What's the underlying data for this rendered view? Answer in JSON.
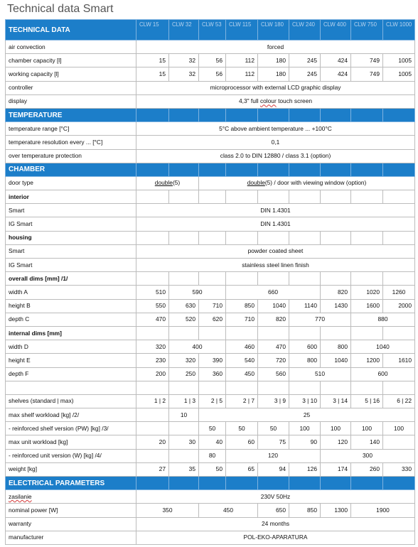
{
  "title": "Technical data Smart",
  "models": [
    "CLW 15",
    "CLW 32",
    "CLW 53",
    "CLW 115",
    "CLW 180",
    "CLW 240",
    "CLW 400",
    "CLW 750",
    "CLW 1000"
  ],
  "sections": {
    "technical": "TECHNICAL DATA",
    "temperature": "TEMPERATURE",
    "chamber": "CHAMBER",
    "electrical": "ELECTRICAL PARAMETERS"
  },
  "rows": {
    "air_convection": {
      "label": "air convection",
      "value": "forced"
    },
    "chamber_capacity": {
      "label": "chamber capacity [l]",
      "values": [
        "15",
        "32",
        "56",
        "112",
        "180",
        "245",
        "424",
        "749",
        "1005"
      ]
    },
    "working_capacity": {
      "label": "working capacity [l]",
      "values": [
        "15",
        "32",
        "56",
        "112",
        "180",
        "245",
        "424",
        "749",
        "1005"
      ]
    },
    "controller": {
      "label": "controller",
      "value": "microprocessor with external LCD graphic display"
    },
    "display": {
      "label": "display",
      "value_a": "4,3\" full ",
      "value_b": "colour",
      "value_c": " touch screen"
    },
    "temp_range": {
      "label": "temperature range [°C]",
      "value": "5°C above ambient temperature ... +100°C"
    },
    "temp_res": {
      "label": "temperature resolution every ... [°C]",
      "value": "0,1"
    },
    "over_temp": {
      "label": "over temperature protection",
      "value": "class 2.0 to DIN 12880 / class 3.1 (option)"
    },
    "door_type": {
      "label": "door type",
      "a_word": "double",
      "a_rest": "(5)",
      "b_word": "double",
      "b_rest": "(5) / door with viewing window (option)"
    },
    "interior": {
      "label": "interior"
    },
    "interior_smart": {
      "label": "Smart",
      "value": "DIN 1.4301"
    },
    "interior_ig": {
      "label": "IG Smart",
      "value": "DIN 1.4301"
    },
    "housing": {
      "label": "housing"
    },
    "housing_smart": {
      "label": "Smart",
      "value": "powder coated sheet"
    },
    "housing_ig": {
      "label": "IG Smart",
      "value": "stainless steel linen finish"
    },
    "overall_dims": {
      "label": "overall dims [mm] /1/"
    },
    "width_a": {
      "label": "width A",
      "v1": "510",
      "v2": "590",
      "v3": "660",
      "v4": "820",
      "v5": "1020",
      "v6": "1260"
    },
    "height_b": {
      "label": "height B",
      "values": [
        "550",
        "630",
        "710",
        "850",
        "1040",
        "1140",
        "1430",
        "1600",
        "2000"
      ]
    },
    "depth_c": {
      "label": "depth C",
      "values": [
        "470",
        "520",
        "620",
        "710",
        "820",
        "770",
        "880"
      ]
    },
    "internal_dims": {
      "label": "internal dims [mm]"
    },
    "width_d": {
      "label": "width D",
      "values": [
        "320",
        "400",
        "460",
        "470",
        "600",
        "800",
        "1040"
      ]
    },
    "height_e": {
      "label": "height E",
      "values": [
        "230",
        "320",
        "390",
        "540",
        "720",
        "800",
        "1040",
        "1200",
        "1610"
      ]
    },
    "depth_f": {
      "label": "depth F",
      "values": [
        "200",
        "250",
        "360",
        "450",
        "560",
        "510",
        "600"
      ]
    },
    "shelves": {
      "label": "shelves (standard | max)",
      "values": [
        "1 | 2",
        "1 | 3",
        "2 | 5",
        "2 | 7",
        "3 | 9",
        "3 | 10",
        "3 | 14",
        "5 | 16",
        "6 | 22"
      ]
    },
    "max_shelf": {
      "label": "max shelf workload [kg] /2/",
      "v1": "10",
      "v2": "25"
    },
    "reinf_shelf": {
      "label": " - reinforced shelf version (PW) [kg] /3/",
      "values": [
        "50",
        "50",
        "50",
        "100",
        "100",
        "100",
        "100"
      ]
    },
    "max_unit": {
      "label": "max unit workload [kg]",
      "values": [
        "20",
        "30",
        "40",
        "60",
        "75",
        "90",
        "120",
        "140"
      ]
    },
    "reinf_unit": {
      "label": " - reinforced unit version (W) [kg] /4/",
      "values": [
        "80",
        "120",
        "300"
      ]
    },
    "weight": {
      "label": "weight [kg]",
      "values": [
        "27",
        "35",
        "50",
        "65",
        "94",
        "126",
        "174",
        "260",
        "330"
      ]
    },
    "zasilanie": {
      "label": "zasilanie",
      "value": "230V 50Hz"
    },
    "nominal_power": {
      "label": "nominal power [W]",
      "values": [
        "350",
        "450",
        "650",
        "850",
        "1300",
        "1900"
      ]
    },
    "warranty": {
      "label": "warranty",
      "value": "24 months"
    },
    "manufacturer": {
      "label": "manufacturer",
      "value": "POL-EKO-APARATURA"
    }
  },
  "colors": {
    "header_blue": "#1c7ec9",
    "model_text": "#b7d3ef",
    "grid": "#bcbcbc",
    "spell_underline": "#d43a3a"
  }
}
